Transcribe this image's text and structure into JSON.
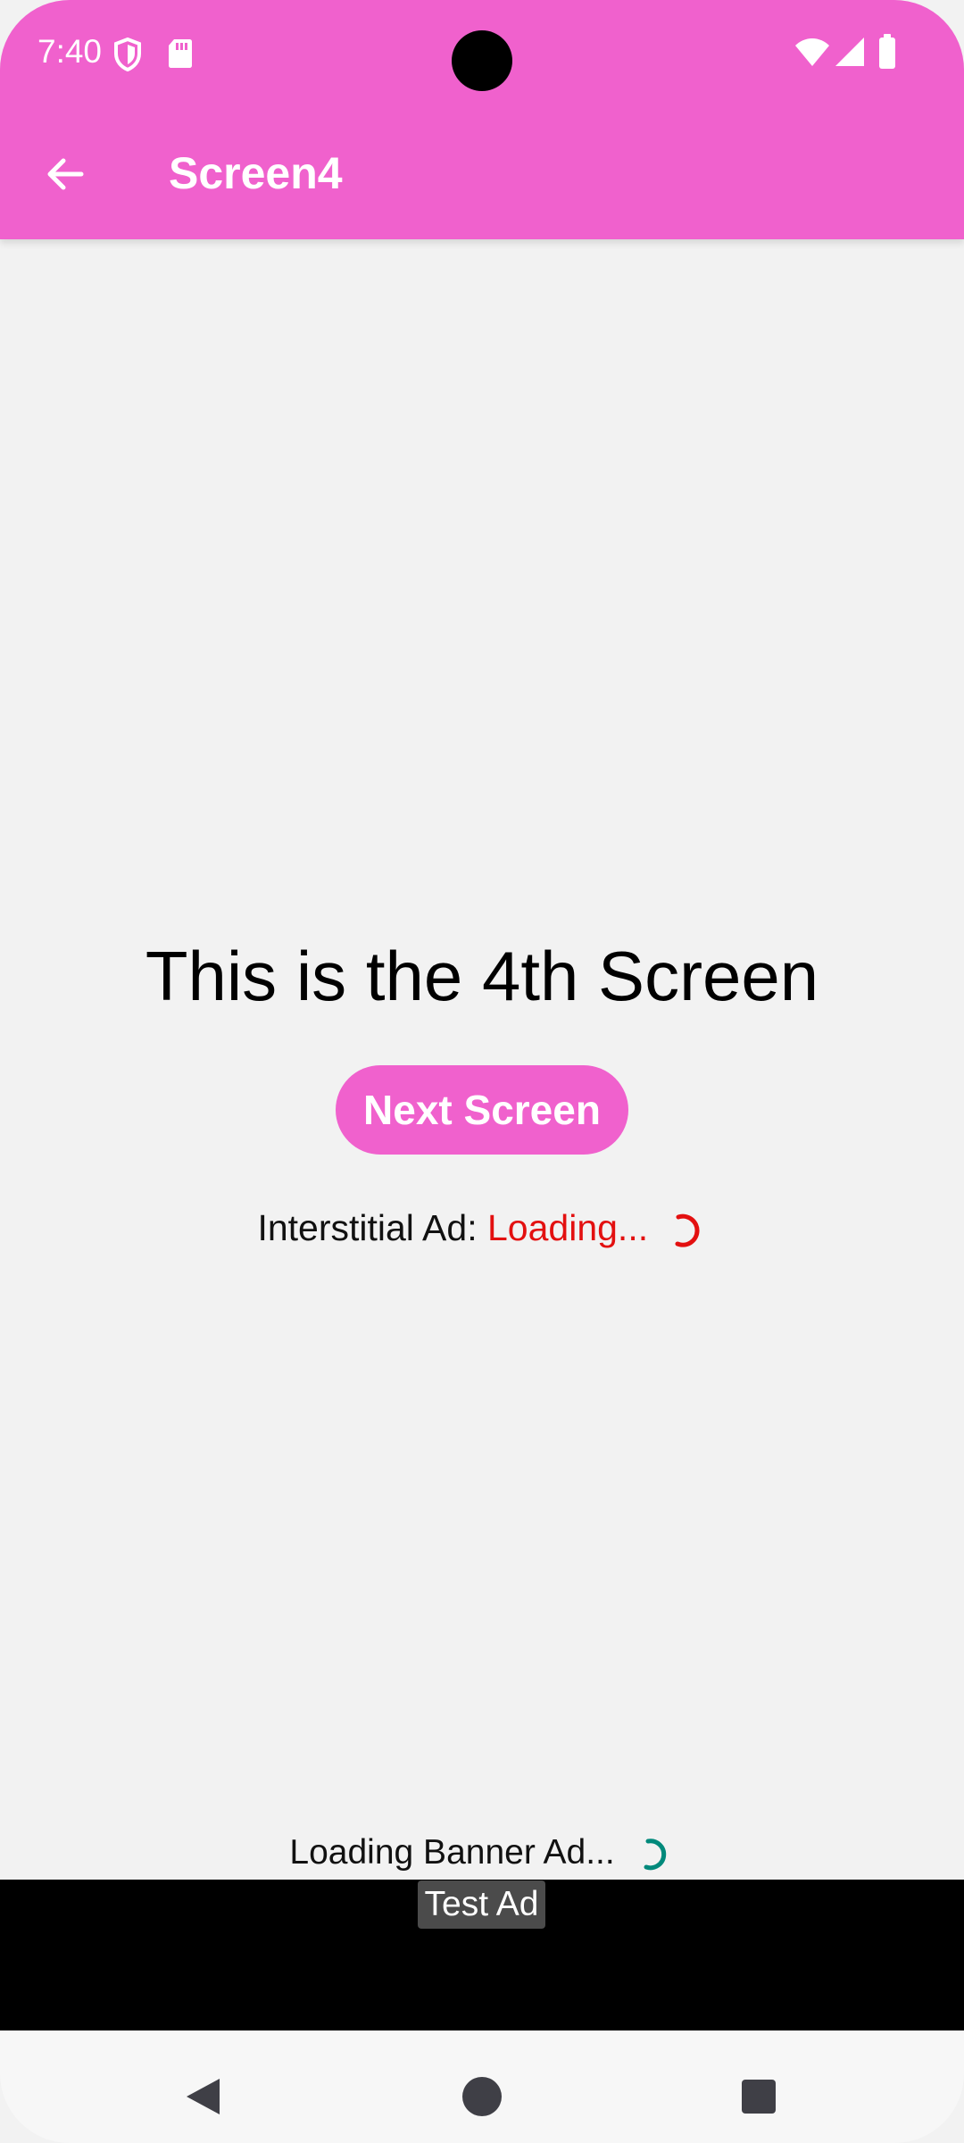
{
  "status_bar": {
    "time": "7:40",
    "icons": [
      "shield-icon",
      "sd-card-icon",
      "wifi-icon",
      "signal-icon",
      "battery-icon"
    ]
  },
  "toolbar": {
    "title": "Screen4",
    "back_icon": "arrow-left-icon"
  },
  "main": {
    "headline": "This is the 4th Screen",
    "next_button_label": "Next Screen",
    "interstitial_label": "Interstitial Ad:",
    "interstitial_status": "Loading..."
  },
  "banner": {
    "loading_text": "Loading Banner Ad...",
    "test_ad_label": "Test Ad"
  },
  "navigation": {
    "back_icon": "back-triangle-icon",
    "home_icon": "home-circle-icon",
    "recents_icon": "recents-square-icon"
  },
  "colors": {
    "accent": "#f061cd",
    "loading_red": "#e31010",
    "spinner_teal": "#00897b",
    "background": "#f2f2f2",
    "banner": "#000000"
  }
}
